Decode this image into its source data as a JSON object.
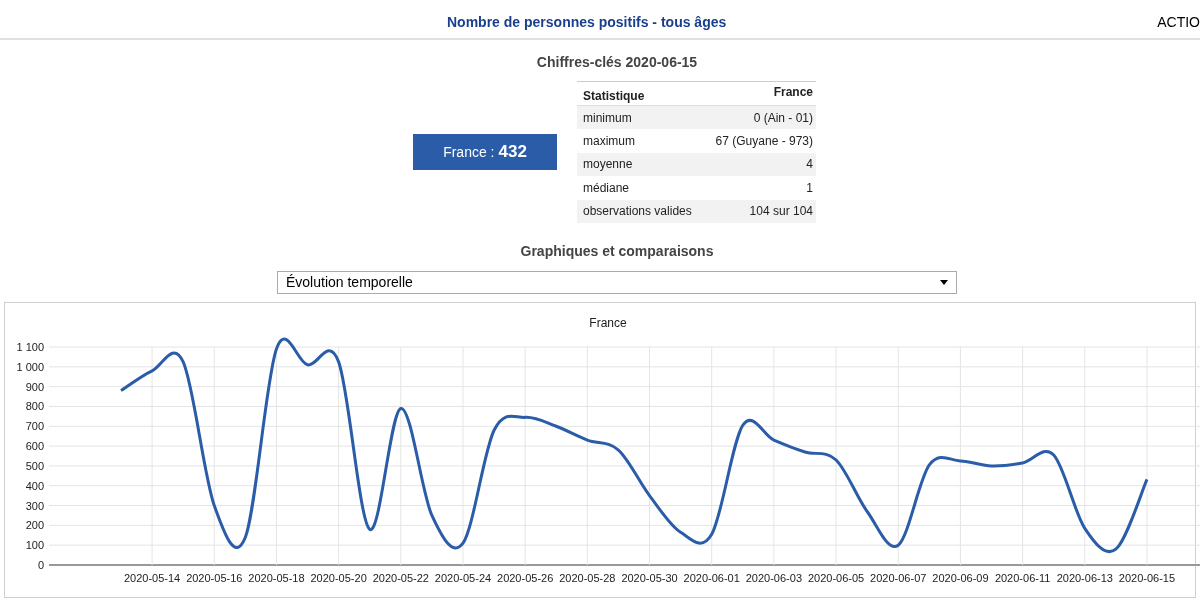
{
  "header": {
    "title": "Nombre de personnes positifs - tous âges",
    "right_label": "ACTIO"
  },
  "key_figures": {
    "title": "Chiffres-clés 2020-06-15",
    "badge_label": "France : ",
    "badge_value": "432",
    "table": {
      "columns": [
        "Statistique",
        "France"
      ],
      "rows": [
        {
          "label": "minimum",
          "value": "0 (Ain - 01)"
        },
        {
          "label": "maximum",
          "value": "67 (Guyane - 973)"
        },
        {
          "label": "moyenne",
          "value": "4"
        },
        {
          "label": "médiane",
          "value": "1"
        },
        {
          "label": "observations valides",
          "value": "104 sur 104"
        }
      ]
    }
  },
  "charts_section": {
    "title": "Graphiques et comparaisons",
    "select": {
      "value": "Évolution temporelle"
    },
    "chart_data": {
      "type": "line",
      "grid": true,
      "categories": [
        null,
        "2020-05-14",
        null,
        "2020-05-16",
        null,
        "2020-05-18",
        null,
        "2020-05-20",
        null,
        "2020-05-22",
        null,
        "2020-05-24",
        null,
        "2020-05-26",
        null,
        "2020-05-28",
        null,
        "2020-05-30",
        null,
        "2020-06-01",
        null,
        "2020-06-03",
        null,
        "2020-06-05",
        null,
        "2020-06-07",
        null,
        "2020-06-09",
        null,
        "2020-06-11",
        null,
        "2020-06-13",
        null,
        "2020-06-15"
      ],
      "series": [
        {
          "name": "France",
          "color": "#2a5ca8",
          "values": [
            880,
            980,
            1025,
            300,
            140,
            1090,
            1010,
            1025,
            180,
            790,
            250,
            110,
            680,
            745,
            700,
            630,
            580,
            350,
            165,
            155,
            705,
            630,
            570,
            530,
            270,
            100,
            505,
            525,
            500,
            515,
            555,
            185,
            80,
            432
          ]
        }
      ],
      "ylim": [
        0,
        1100
      ],
      "yticks": [
        {
          "value": 0,
          "label": "0"
        },
        {
          "value": 100,
          "label": "100"
        },
        {
          "value": 200,
          "label": "200"
        },
        {
          "value": 300,
          "label": "300"
        },
        {
          "value": 400,
          "label": "400"
        },
        {
          "value": 500,
          "label": "500"
        },
        {
          "value": 600,
          "label": "600"
        },
        {
          "value": 700,
          "label": "700"
        },
        {
          "value": 800,
          "label": "800"
        },
        {
          "value": 900,
          "label": "900"
        },
        {
          "value": 1000,
          "label": "1 000"
        },
        {
          "value": 1100,
          "label": "1 100"
        }
      ]
    }
  }
}
